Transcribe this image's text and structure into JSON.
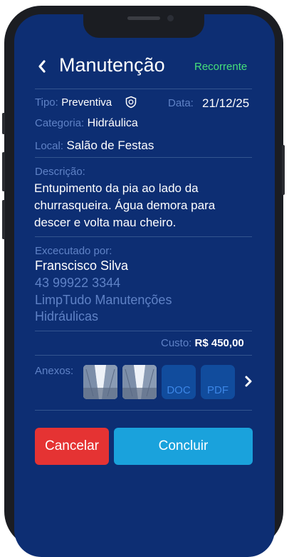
{
  "header": {
    "title": "Manutenção",
    "recurring_label": "Recorrente"
  },
  "details": {
    "tipo_label": "Tipo:",
    "tipo_value": "Preventiva",
    "data_label": "Data:",
    "data_value": "21/12/25",
    "categoria_label": "Categoria:",
    "categoria_value": "Hidráulica",
    "local_label": "Local:",
    "local_value": "Salão de Festas"
  },
  "descricao": {
    "label": "Descrição:",
    "text": "Entupimento da pia ao lado da churrasqueira. Água demora para descer e volta mau cheiro."
  },
  "executado": {
    "label": "Excecutado por:",
    "name": "Franscisco Silva",
    "phone": "43 99922 3344",
    "company": "LimpTudo Manutenções Hidráulicas"
  },
  "custo": {
    "label": "Custo:",
    "value": "R$ 450,00"
  },
  "anexos": {
    "label": "Anexos:",
    "doc_label": "DOC",
    "pdf_label": "PDF"
  },
  "actions": {
    "cancel_label": "Cancelar",
    "confirm_label": "Concluir"
  },
  "colors": {
    "background": "#0d2e73",
    "accent_green": "#46e07a",
    "cancel_red": "#e53333",
    "confirm_blue": "#1aa2dc"
  }
}
